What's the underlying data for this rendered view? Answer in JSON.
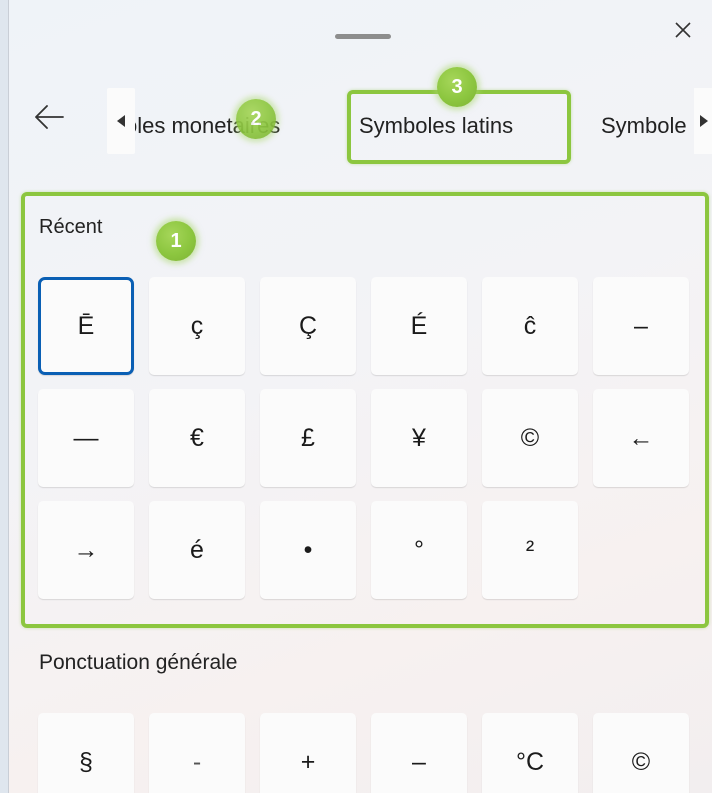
{
  "window": {
    "drag_handle": "drag-handle",
    "close_icon": "close-icon"
  },
  "nav": {
    "back_icon": "arrow-left-icon",
    "scroll_left_icon": "caret-left-icon",
    "scroll_right_icon": "caret-right-icon",
    "tabs": [
      {
        "label": "oles monetaires",
        "selected": false
      },
      {
        "label": "Symboles latins",
        "selected": true
      },
      {
        "label": "Symbole",
        "selected": false
      }
    ]
  },
  "sections": {
    "recent": {
      "title": "Récent",
      "keys": [
        "Ē",
        "ç",
        "Ç",
        "É",
        "ĉ",
        "–",
        "—",
        "€",
        "£",
        "¥",
        "©",
        "←",
        "→",
        "é",
        "•",
        "°",
        "²"
      ]
    },
    "punctuation": {
      "title": "Ponctuation générale",
      "keys": [
        "§",
        "-",
        "+",
        "–",
        "°C",
        "©"
      ]
    }
  },
  "annotations": {
    "markers": [
      "1",
      "2",
      "3"
    ],
    "highlight_color": "#8cc63f"
  },
  "colors": {
    "selection_border": "#0a5fb4",
    "key_background": "#fbfbfb"
  }
}
